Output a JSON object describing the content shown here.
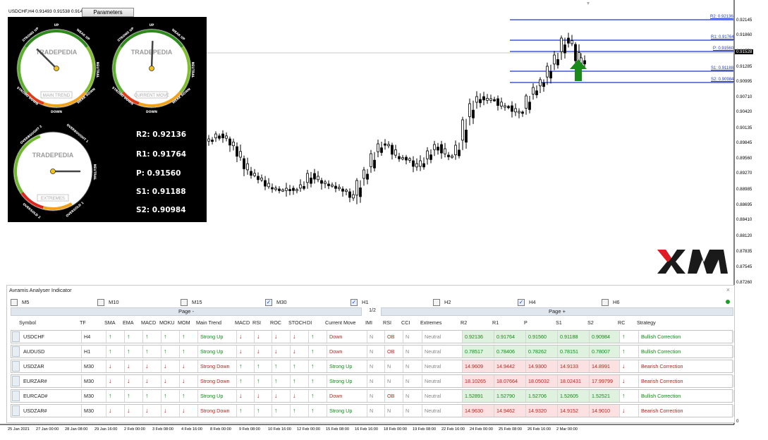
{
  "header": {
    "symbol_text": "USDCHF,H4  0.91493 0.91538 0.914",
    "params_button": "Parameters"
  },
  "gauges": {
    "brand": "TRADEPEDIA",
    "g1": {
      "label": "MAIN TREND",
      "up": "UP",
      "down": "DOWN",
      "strong_up": "STRONG UP",
      "weak_up": "WEAK UP",
      "neutral": "NEUTRAL",
      "strong_down": "STRONG DOWN",
      "weak_down": "WEAK DOWN"
    },
    "g2": {
      "label": "CURRENT MOVE",
      "up": "UP",
      "down": "DOWN",
      "strong_up": "STRONG UP",
      "weak_up": "WEAK UP",
      "neutral": "NEUTRAL",
      "strong_down": "STRONG DOWN",
      "weak_down": "WEAK DOWN"
    },
    "g3": {
      "label": "EXTREMES",
      "ob2": "OVERBOUGHT 2",
      "ob1": "OVERBOUGHT 1",
      "neutral": "NEUTRAL",
      "os2": "OVERSOLD 2",
      "os1": "OVERSOLD 1"
    }
  },
  "pivots": {
    "r2": "R2: 0.92136",
    "r1": "R1: 0.91764",
    "p": "P:  0.91560",
    "s1": "S1: 0.91188",
    "s2": "S2: 0.90984"
  },
  "level_labels": {
    "r2": "R2: 0.92136",
    "r1": "R1: 0.91764",
    "p": "P: 0.91560",
    "s1": "S1: 0.91188",
    "s2": "S2: 0.90984"
  },
  "price_axis": [
    "0.92145",
    "0.91860",
    "0.91570",
    "0.91285",
    "0.90995",
    "0.90710",
    "0.90420",
    "0.90135",
    "0.89845",
    "0.89560",
    "0.89270",
    "0.88985",
    "0.88695",
    "0.88410",
    "0.88120",
    "0.87835",
    "0.87545",
    "0.87260",
    "0"
  ],
  "current_price": "0.91528",
  "time_axis": [
    "25 Jan 2021",
    "27 Jan 00:00",
    "28 Jan 08:00",
    "29 Jan 16:00",
    "2 Feb 00:00",
    "3 Feb 08:00",
    "4 Feb 16:00",
    "8 Feb 00:00",
    "9 Feb 08:00",
    "10 Feb 16:00",
    "12 Feb 00:00",
    "15 Feb 08:00",
    "16 Feb 16:00",
    "18 Feb 00:00",
    "19 Feb 08:00",
    "22 Feb 16:00",
    "24 Feb 00:00",
    "25 Feb 08:00",
    "26 Feb 16:00",
    "2 Mar 00:00"
  ],
  "panel": {
    "title": "Avramis Analyser Indicator",
    "close": "×",
    "timeframes": [
      {
        "label": "M5",
        "checked": false
      },
      {
        "label": "M10",
        "checked": false
      },
      {
        "label": "M15",
        "checked": false
      },
      {
        "label": "M30",
        "checked": true
      },
      {
        "label": "H1",
        "checked": true
      },
      {
        "label": "H2",
        "checked": false
      },
      {
        "label": "H4",
        "checked": true
      },
      {
        "label": "H6",
        "checked": false
      }
    ],
    "page_prev": "Page -",
    "page_num": "1/2",
    "page_next": "Page +",
    "columns": [
      "Symbol",
      "TF",
      "SMA",
      "EMA",
      "MACD",
      "MOKU",
      "MOM",
      "Main Trend",
      "MACD",
      "RSI",
      "ROC",
      "STOCH",
      "DI",
      "Current Move",
      "IMI",
      "RSI",
      "CCI",
      "Extremes",
      "R2",
      "R1",
      "P",
      "S1",
      "S2",
      "RC",
      "Strategy"
    ],
    "rows": [
      {
        "symbol": "USDCHF",
        "tf": "H4",
        "sig1": [
          "up",
          "up",
          "up",
          "up",
          "up"
        ],
        "main": "Strong Up",
        "sig2": [
          "dn",
          "dn",
          "dn",
          "dn",
          "up"
        ],
        "move": "Down",
        "imi": "N",
        "rsi": "OB",
        "cci": "N",
        "ext": "Neutral",
        "r2": "0.92136",
        "r1": "0.91764",
        "p": "0.91560",
        "s1": "0.91188",
        "s2": "0.90984",
        "rc": "up",
        "strategy": "Bullish Correction"
      },
      {
        "symbol": "AUDUSD",
        "tf": "H1",
        "sig1": [
          "up",
          "up",
          "up",
          "up",
          "up"
        ],
        "main": "Strong Up",
        "sig2": [
          "dn",
          "dn",
          "dn",
          "dn",
          "up"
        ],
        "move": "Down",
        "imi": "N",
        "rsi": "OB",
        "cci": "N",
        "ext": "Neutral",
        "r2": "0.78517",
        "r1": "0.78406",
        "p": "0.78262",
        "s1": "0.78151",
        "s2": "0.78007",
        "rc": "up",
        "strategy": "Bullish Correction"
      },
      {
        "symbol": "USDZAR",
        "tf": "M30",
        "sig1": [
          "dn",
          "dn",
          "dn",
          "dn",
          "dn"
        ],
        "main": "Strong Down",
        "sig2": [
          "up",
          "up",
          "up",
          "up",
          "up"
        ],
        "move": "Strong Up",
        "imi": "N",
        "rsi": "N",
        "cci": "N",
        "ext": "Neutral",
        "r2": "14.9609",
        "r1": "14.9442",
        "p": "14.9300",
        "s1": "14.9133",
        "s2": "14.8991",
        "rc": "dn",
        "strategy": "Bearish Correction"
      },
      {
        "symbol": "EURZAR#",
        "tf": "M30",
        "sig1": [
          "dn",
          "dn",
          "dn",
          "dn",
          "dn"
        ],
        "main": "Strong Down",
        "sig2": [
          "up",
          "up",
          "up",
          "up",
          "up"
        ],
        "move": "Strong Up",
        "imi": "N",
        "rsi": "N",
        "cci": "N",
        "ext": "Neutral",
        "r2": "18.10265",
        "r1": "18.07664",
        "p": "18.05032",
        "s1": "18.02431",
        "s2": "17.99799",
        "rc": "dn",
        "strategy": "Bearish Correction"
      },
      {
        "symbol": "EURCAD#",
        "tf": "M30",
        "sig1": [
          "up",
          "up",
          "up",
          "up",
          "up"
        ],
        "main": "Strong Up",
        "sig2": [
          "dn",
          "dn",
          "dn",
          "dn",
          "up"
        ],
        "move": "Down",
        "imi": "N",
        "rsi": "OB",
        "cci": "N",
        "ext": "Neutral",
        "r2": "1.52891",
        "r1": "1.52790",
        "p": "1.52706",
        "s1": "1.52605",
        "s2": "1.52521",
        "rc": "up",
        "strategy": "Bullish Correction"
      },
      {
        "symbol": "USDZAR#",
        "tf": "M30",
        "sig1": [
          "dn",
          "dn",
          "dn",
          "dn",
          "dn"
        ],
        "main": "Strong Down",
        "sig2": [
          "up",
          "up",
          "up",
          "up",
          "up"
        ],
        "move": "Strong Up",
        "imi": "N",
        "rsi": "N",
        "cci": "N",
        "ext": "Neutral",
        "r2": "14.9630",
        "r1": "14.9462",
        "p": "14.9320",
        "s1": "14.9152",
        "s2": "14.9010",
        "rc": "dn",
        "strategy": "Bearish Correction"
      }
    ]
  },
  "colors": {
    "up": "#0a8d12",
    "down": "#c41616",
    "level_line": "#1f35d6",
    "arrow": "#1a8a1a"
  },
  "icons": {
    "up_arrow": "arrow-up-icon",
    "down_arrow": "arrow-down-icon",
    "folder": "folder-icon",
    "signal": "big-up-arrow-icon"
  },
  "brand_logo_text": "XM"
}
